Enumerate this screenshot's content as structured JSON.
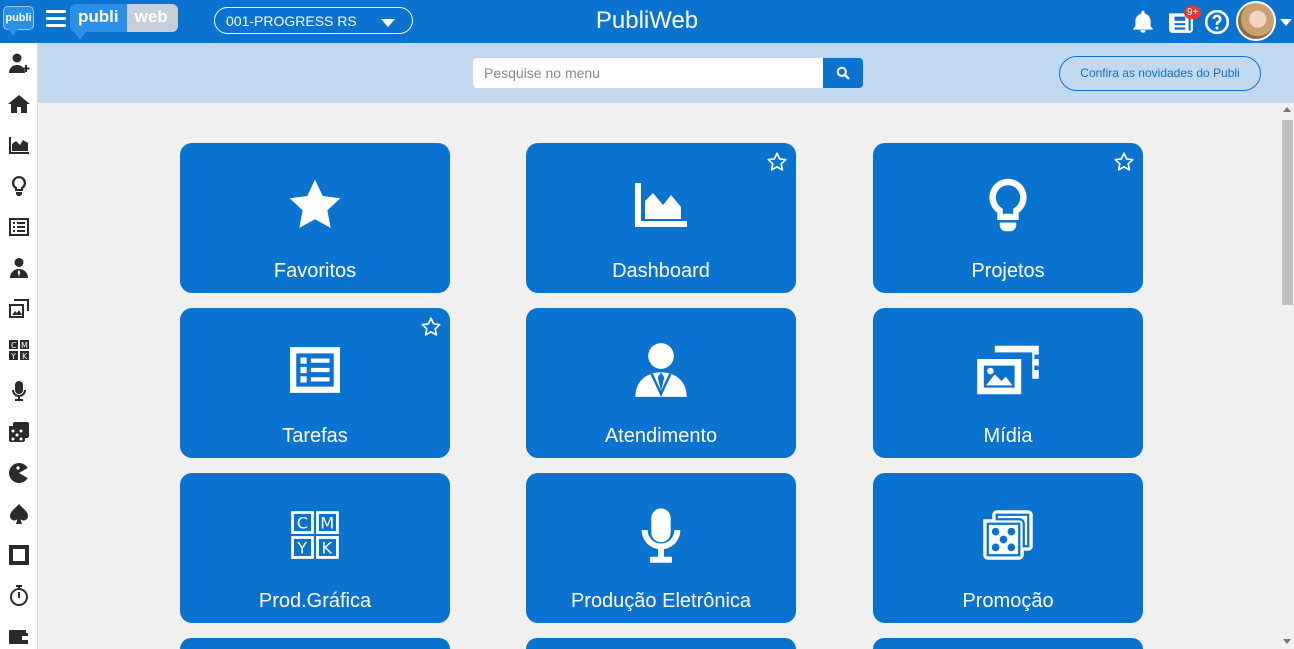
{
  "header": {
    "logo_small": "publi",
    "brand_part1": "publi",
    "brand_part2": "web",
    "company_select": "001-PROGRESS RS",
    "title": "PubliWeb",
    "notification_badge": "9+",
    "icons": [
      "bell-icon",
      "news-icon",
      "help-icon",
      "avatar"
    ]
  },
  "search": {
    "placeholder": "Pesquise no menu",
    "value": ""
  },
  "news_button": "Confira as novidades do Publi",
  "sidebar": {
    "items": [
      "add-user-icon",
      "home-icon",
      "chart-area-icon",
      "lightbulb-icon",
      "list-icon",
      "user-tie-icon",
      "media-icon",
      "cmyk-icon",
      "microphone-icon",
      "dice-icon",
      "pacman-icon",
      "spade-icon",
      "square-icon",
      "stopwatch-icon",
      "wallet-icon"
    ]
  },
  "tiles": [
    {
      "label": "Favoritos",
      "icon": "star-icon",
      "favorite_marker": false
    },
    {
      "label": "Dashboard",
      "icon": "chart-area-icon",
      "favorite_marker": true
    },
    {
      "label": "Projetos",
      "icon": "lightbulb-icon",
      "favorite_marker": true
    },
    {
      "label": "Tarefas",
      "icon": "list-icon",
      "favorite_marker": true
    },
    {
      "label": "Atendimento",
      "icon": "user-tie-icon",
      "favorite_marker": false
    },
    {
      "label": "Mídia",
      "icon": "media-icon",
      "favorite_marker": false
    },
    {
      "label": "Prod.Gráfica",
      "icon": "cmyk-icon",
      "favorite_marker": false
    },
    {
      "label": "Produção Eletrônica",
      "icon": "microphone-icon",
      "favorite_marker": false
    },
    {
      "label": "Promoção",
      "icon": "dice-icon",
      "favorite_marker": false
    }
  ],
  "colors": {
    "primary": "#0a72cf",
    "band": "#c2d8ee",
    "background": "#f0f0f0"
  }
}
